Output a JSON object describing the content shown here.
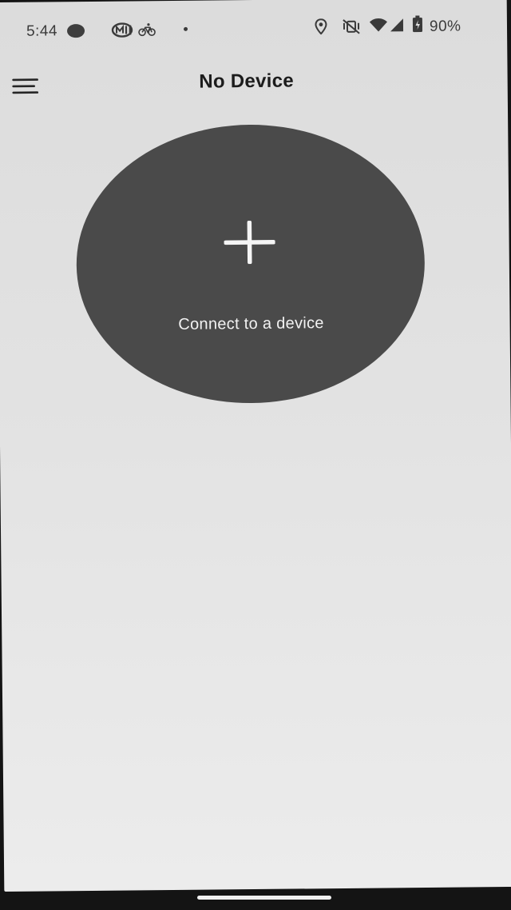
{
  "status_bar": {
    "time": "5:44",
    "battery_percent": "90%",
    "icons": [
      "notification-dot-icon",
      "media-icon",
      "bicycle-icon",
      "small-dot-icon",
      "location-icon",
      "vibrate-off-icon",
      "wifi-icon",
      "signal-icon",
      "battery-icon"
    ]
  },
  "header": {
    "title": "No Device",
    "menu_icon": "hamburger-menu-icon"
  },
  "main": {
    "connect_label": "Connect to a device",
    "connect_icon": "plus-icon"
  },
  "colors": {
    "background": "#e3e3e3",
    "button": "#4a4a4a",
    "button_text": "#f2f2f2",
    "title_text": "#1c1c1c"
  }
}
